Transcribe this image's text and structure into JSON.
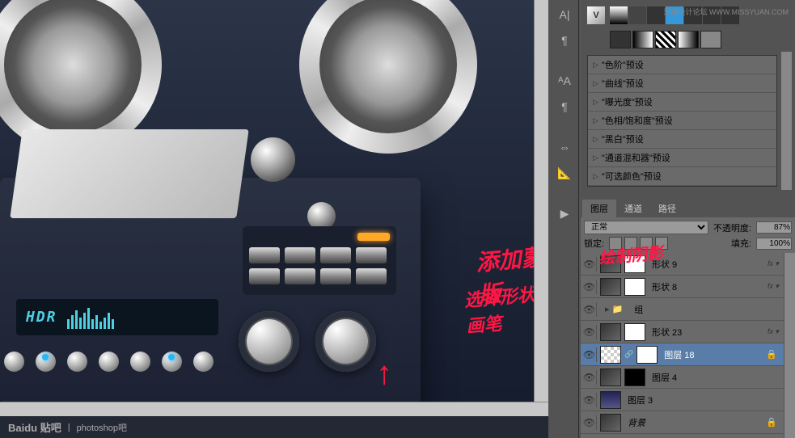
{
  "watermark": "思缘设计论坛 WWW.MISSYUAN.COM",
  "hdr_text": "HDR",
  "presets": {
    "items": [
      "\"色阶\"预设",
      "\"曲线\"预设",
      "\"曝光度\"预设",
      "\"色相/饱和度\"预设",
      "\"黑白\"预设",
      "\"通道混和器\"预设",
      "\"可选颜色\"预设"
    ]
  },
  "layers_panel": {
    "tabs": [
      "图层",
      "通道",
      "路径"
    ],
    "blend_mode": "正常",
    "opacity_label": "不透明度:",
    "opacity_value": "87%",
    "lock_label": "锁定:",
    "fill_label": "填充:",
    "fill_value": "100%",
    "layers": [
      {
        "name": "形状 9",
        "fx": true,
        "mask": "white",
        "thumb": "dark"
      },
      {
        "name": "形状 8",
        "fx": true,
        "mask": "white",
        "thumb": "dark"
      },
      {
        "name": "组",
        "group": true
      },
      {
        "name": "形状 23",
        "fx": true,
        "mask": "white",
        "thumb": "dark"
      },
      {
        "name": "图层 18",
        "selected": true,
        "mask": "white",
        "thumb": "checker",
        "link": true
      },
      {
        "name": "图层 4",
        "mask": "white",
        "thumb": "dark"
      },
      {
        "name": "图层 3",
        "thumb": "grad"
      },
      {
        "name": "背景",
        "locked": true,
        "thumb": "dark"
      }
    ]
  },
  "annotations": {
    "a1": "添加蒙版",
    "a2": "选择形状画笔",
    "a3": "绘制阴影"
  },
  "footer": {
    "logo": "Baidu 贴吧",
    "sep": "|",
    "board": "photoshop吧"
  }
}
